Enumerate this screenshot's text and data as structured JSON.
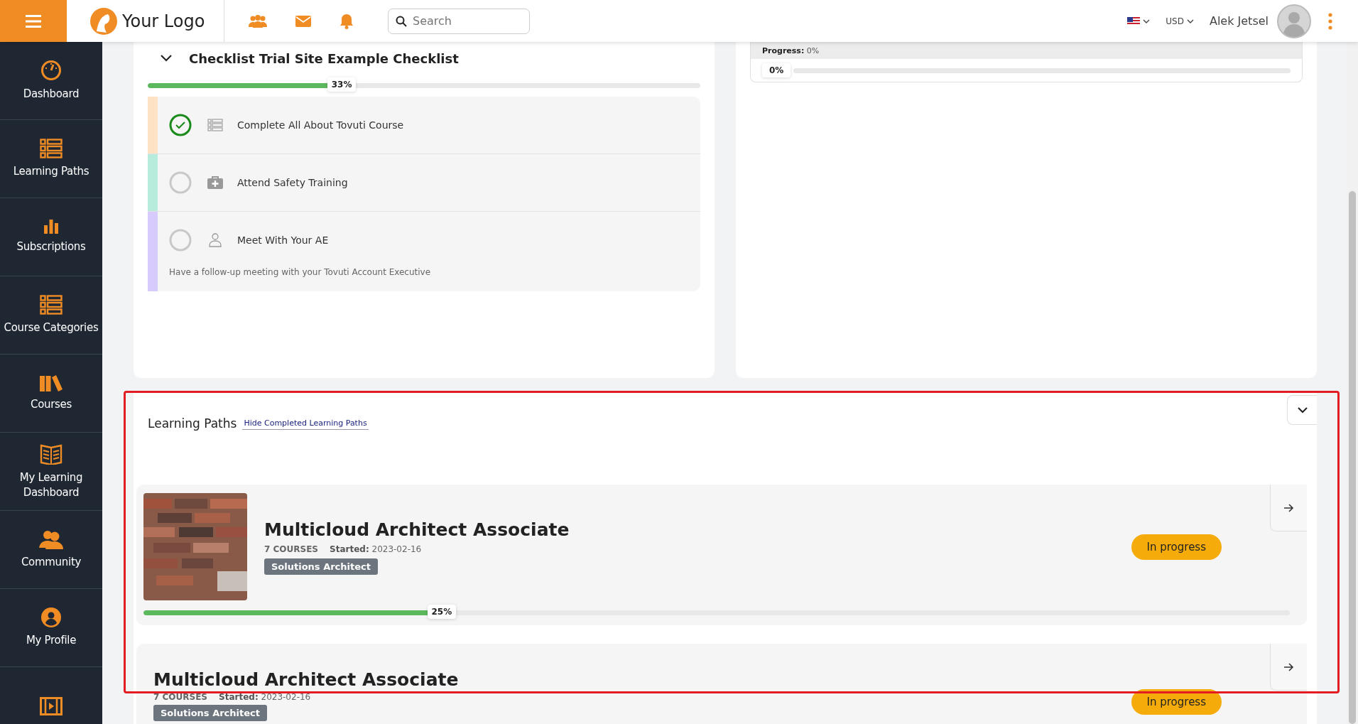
{
  "topbar": {
    "logo_text": "Your Logo",
    "search": {
      "placeholder": "Search"
    },
    "currency": "USD",
    "user_name": "Alek Jetsel"
  },
  "sidebar": {
    "items": [
      {
        "label": "Dashboard",
        "kind": "gauge"
      },
      {
        "label": "Learning Paths",
        "kind": "list"
      },
      {
        "label": "Subscriptions",
        "kind": "bars"
      },
      {
        "label": "Course Categories",
        "kind": "list"
      },
      {
        "label": "Courses",
        "kind": "books"
      },
      {
        "label": "My Learning Dashboard",
        "kind": "book"
      },
      {
        "label": "Community",
        "kind": "people"
      },
      {
        "label": "My Profile",
        "kind": "profile"
      },
      {
        "kind": "film"
      }
    ]
  },
  "checklist": {
    "title": "Checklist Trial Site Example Checklist",
    "level": 0.33,
    "percent": "33%",
    "expanded": true,
    "items": [
      {
        "label": "Complete All About Tovuti Course",
        "checked": true,
        "color": "#fde3c4",
        "kind": "course"
      },
      {
        "label": "Attend Safety Training",
        "checked": false,
        "color": "#b7ecdc",
        "kind": "training"
      },
      {
        "label": "Meet With Your AE",
        "checked": false,
        "color": "#d6cbfb",
        "kind": "meeting",
        "description": "Have a follow-up meeting with your Tovuti Account Executive"
      }
    ]
  },
  "side_progress": {
    "label": "Progress:",
    "value": "0%",
    "level": 0,
    "percent": "0%"
  },
  "learning_paths": {
    "title": "Learning Paths",
    "hide_link": "Hide Completed Learning Paths",
    "paths": [
      {
        "title": "Multicloud Architect Associate",
        "courses": "7 COURSES",
        "started_label": "Started:",
        "started": "2023-02-16",
        "tag": "Solutions Architect",
        "status": "In progress",
        "image": true,
        "level": 0.25,
        "percent": "25%"
      },
      {
        "title": "Multicloud Architect Associate",
        "courses": "7 COURSES",
        "started_label": "Started:",
        "started": "2023-02-16",
        "tag": "Solutions Architect",
        "status": "In progress",
        "image": false
      }
    ]
  }
}
